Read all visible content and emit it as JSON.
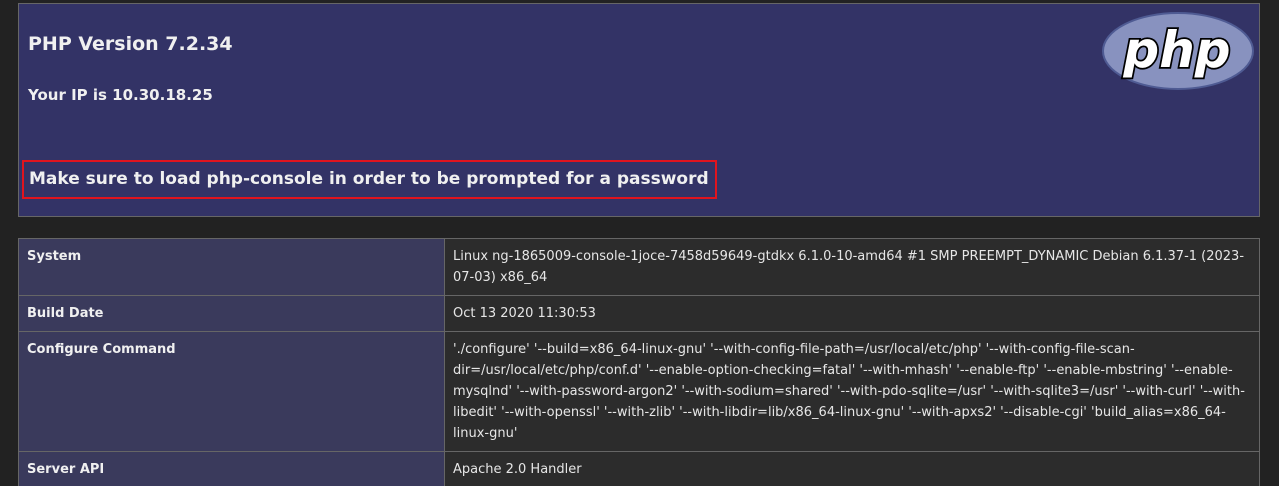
{
  "header": {
    "title": "PHP Version 7.2.34",
    "ip_line": "Your IP is 10.30.18.25",
    "warning": "Make sure to load php-console in order to be prompted for a password",
    "logo_text": "php",
    "logo_color": "#8892bf",
    "background_color": "#333366",
    "warning_border_color": "#e0141e"
  },
  "table": {
    "rows": [
      {
        "key": "System",
        "value": "Linux ng-1865009-console-1joce-7458d59649-gtdkx 6.1.0-10-amd64 #1 SMP PREEMPT_DYNAMIC Debian 6.1.37-1 (2023-07-03) x86_64"
      },
      {
        "key": "Build Date",
        "value": "Oct 13 2020 11:30:53"
      },
      {
        "key": "Configure Command",
        "value": "'./configure' '--build=x86_64-linux-gnu' '--with-config-file-path=/usr/local/etc/php' '--with-config-file-scan-dir=/usr/local/etc/php/conf.d' '--enable-option-checking=fatal' '--with-mhash' '--enable-ftp' '--enable-mbstring' '--enable-mysqlnd' '--with-password-argon2' '--with-sodium=shared' '--with-pdo-sqlite=/usr' '--with-sqlite3=/usr' '--with-curl' '--with-libedit' '--with-openssl' '--with-zlib' '--with-libdir=lib/x86_64-linux-gnu' '--with-apxs2' '--disable-cgi' 'build_alias=x86_64-linux-gnu'"
      },
      {
        "key": "Server API",
        "value": "Apache 2.0 Handler"
      }
    ]
  }
}
